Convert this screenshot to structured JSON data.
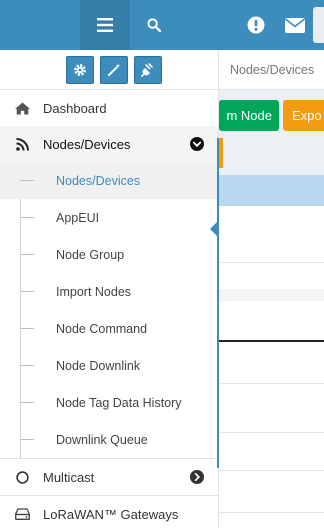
{
  "topbar": {
    "menu_icon": "bars-icon",
    "search_icon": "search-icon",
    "alert_icon": "exclamation-circle-icon",
    "mail_icon": "envelope-icon",
    "color": "#3c8dbc"
  },
  "sidebar": {
    "tools": [
      {
        "name": "gear-icon"
      },
      {
        "name": "magic-wand-icon"
      },
      {
        "name": "plug-icon"
      }
    ],
    "items": [
      {
        "label": "Dashboard",
        "icon": "home-icon"
      },
      {
        "label": "Nodes/Devices",
        "icon": "rss-icon",
        "expanded": true
      },
      {
        "label": "Multicast",
        "icon": "circle-outline-icon"
      },
      {
        "label": "LoRaWAN™ Gateways",
        "icon": "hdd-icon"
      }
    ],
    "submenu": [
      {
        "label": "Nodes/Devices",
        "selected": true
      },
      {
        "label": "AppEUI"
      },
      {
        "label": "Node Group"
      },
      {
        "label": "Import Nodes"
      },
      {
        "label": "Node Command"
      },
      {
        "label": "Node Downlink"
      },
      {
        "label": "Node Tag Data History"
      },
      {
        "label": "Downlink Queue"
      }
    ]
  },
  "main": {
    "breadcrumb": "Nodes/Devices",
    "green_button": "m Node",
    "orange_button": "Expo"
  }
}
